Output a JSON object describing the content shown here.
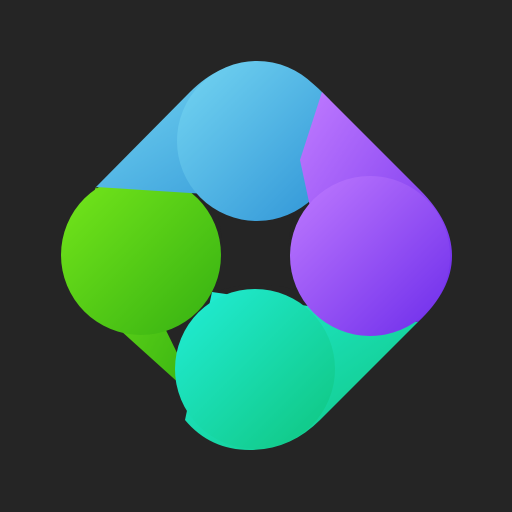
{
  "icon": {
    "name": "four-petal-diamond-logo-icon",
    "colors": {
      "background": "#252525",
      "petal_top": [
        "#75D6F2",
        "#2E93D6"
      ],
      "petal_right": [
        "#C07BFF",
        "#6C2BEA"
      ],
      "petal_bottom": [
        "#22EED8",
        "#0FC57E"
      ],
      "petal_left": [
        "#76E81B",
        "#35B012"
      ],
      "center": "#252525"
    }
  }
}
